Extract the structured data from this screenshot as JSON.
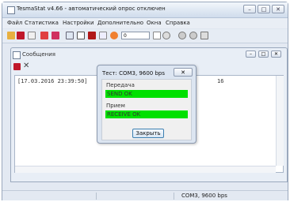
{
  "app": {
    "title": "TesmaStat v4.66 - автоматический опрос отключен",
    "caption_buttons": {
      "minimize": "–",
      "maximize": "□",
      "close": "✕"
    }
  },
  "menu": [
    "Файл",
    "Статистика",
    "Настройки",
    "Дополнительно",
    "Окна",
    "Справка"
  ],
  "toolbar": {
    "input_value": "0"
  },
  "child_window": {
    "title": "Сообщения",
    "log_line": "[17.03.2016 23:39:50]",
    "log_line_tail": "16"
  },
  "dialog": {
    "title": "Тест: COM3, 9600 bps",
    "close_label": "✕",
    "send_group_label": "Передача",
    "send_status": "SEND OK",
    "receive_group_label": "Прием",
    "receive_status": "RECEIVE OK",
    "close_button_label": "Закрыть"
  },
  "status": {
    "connection": "COM3, 9600 bps"
  },
  "colors": {
    "ok_green": "#00e000",
    "titlebar": "#cfdcec"
  }
}
